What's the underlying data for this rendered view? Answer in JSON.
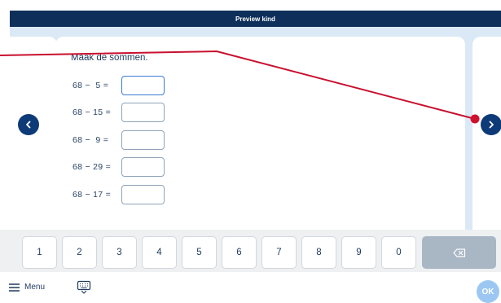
{
  "header": {
    "title": "Preview kind"
  },
  "exercise": {
    "instruction": "Maak de sommen.",
    "sums": [
      {
        "expression": "68 −  5 ="
      },
      {
        "expression": "68 − 15 ="
      },
      {
        "expression": "68 −  9 ="
      },
      {
        "expression": "68 − 29 ="
      },
      {
        "expression": "68 − 17 ="
      }
    ]
  },
  "keypad": {
    "keys": [
      "1",
      "2",
      "3",
      "4",
      "5",
      "6",
      "7",
      "8",
      "9",
      "0"
    ],
    "backspace_icon": "backspace-icon"
  },
  "footer": {
    "menu_label": "Menu",
    "keyboard_icon": "keyboard-icon",
    "ok_label": "OK"
  },
  "colors": {
    "header_bg": "#0e2f5a",
    "stage_bg": "#dbe9f6",
    "nav_arrow": "#0e3a78",
    "annotation_line": "#c8102e",
    "ok_button": "#9cc7f2"
  }
}
